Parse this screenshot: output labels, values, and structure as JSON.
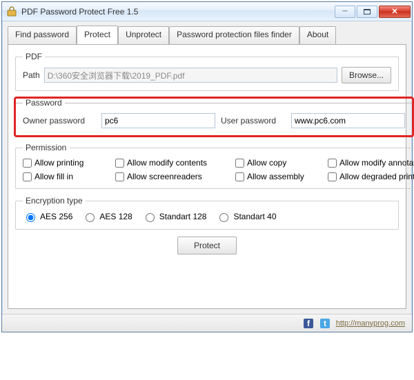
{
  "window": {
    "title": "PDF Password Protect Free 1.5"
  },
  "tabs": {
    "find": "Find password",
    "protect": "Protect",
    "unprotect": "Unprotect",
    "finder": "Password protection files finder",
    "about": "About"
  },
  "pdf": {
    "legend": "PDF",
    "path_label": "Path",
    "path_value": "D:\\360安全浏览器下载\\2019_PDF.pdf",
    "browse": "Browse..."
  },
  "password": {
    "legend": "Password",
    "owner_label": "Owner password",
    "owner_value": "pc6",
    "user_label": "User password",
    "user_value": "www.pc6.com"
  },
  "permission": {
    "legend": "Permission",
    "allow_printing": "Allow printing",
    "allow_modify_contents": "Allow modify contents",
    "allow_copy": "Allow copy",
    "allow_modify_annotations": "Allow modify annotations",
    "allow_fill_in": "Allow fill in",
    "allow_screenreaders": "Allow screenreaders",
    "allow_assembly": "Allow assembly",
    "allow_degraded_printing": "Allow degraded printing"
  },
  "encryption": {
    "legend": "Encryption type",
    "aes256": "AES 256",
    "aes128": "AES 128",
    "std128": "Standart 128",
    "std40": "Standart 40",
    "selected": "aes256"
  },
  "actions": {
    "protect": "Protect"
  },
  "status": {
    "link": "http://manyprog.com"
  }
}
